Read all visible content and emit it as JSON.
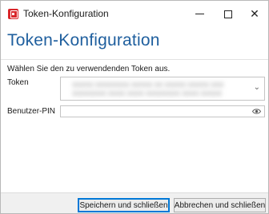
{
  "window": {
    "title": "Token-Konfiguration",
    "minimize_glyph": "minimize",
    "maximize_glyph": "maximize",
    "close_glyph": "✕"
  },
  "header": {
    "title": "Token-Konfiguration"
  },
  "form": {
    "instruction": "Wählen Sie den zu verwendenden Token aus.",
    "token_label": "Token",
    "token_value_line1": "XXXXX XXXXXXXX XXXXX XX XXXXX XXXXX XXX",
    "token_value_line2": "XXXXXXXX XXXX XXXX XXXXXXXX XXXX XXXXX",
    "token_chevron": "⌄",
    "pin_label": "Benutzer-PIN",
    "pin_value": ""
  },
  "footer": {
    "save_label": "Speichern und schließen",
    "cancel_label": "Abbrechen und schließen"
  },
  "colors": {
    "header_title": "#1f5f9e",
    "app_icon": "#d9262a",
    "default_button_border": "#0078d7"
  },
  "icons": {
    "app": "token-app-icon",
    "password_reveal": "eye-icon"
  }
}
